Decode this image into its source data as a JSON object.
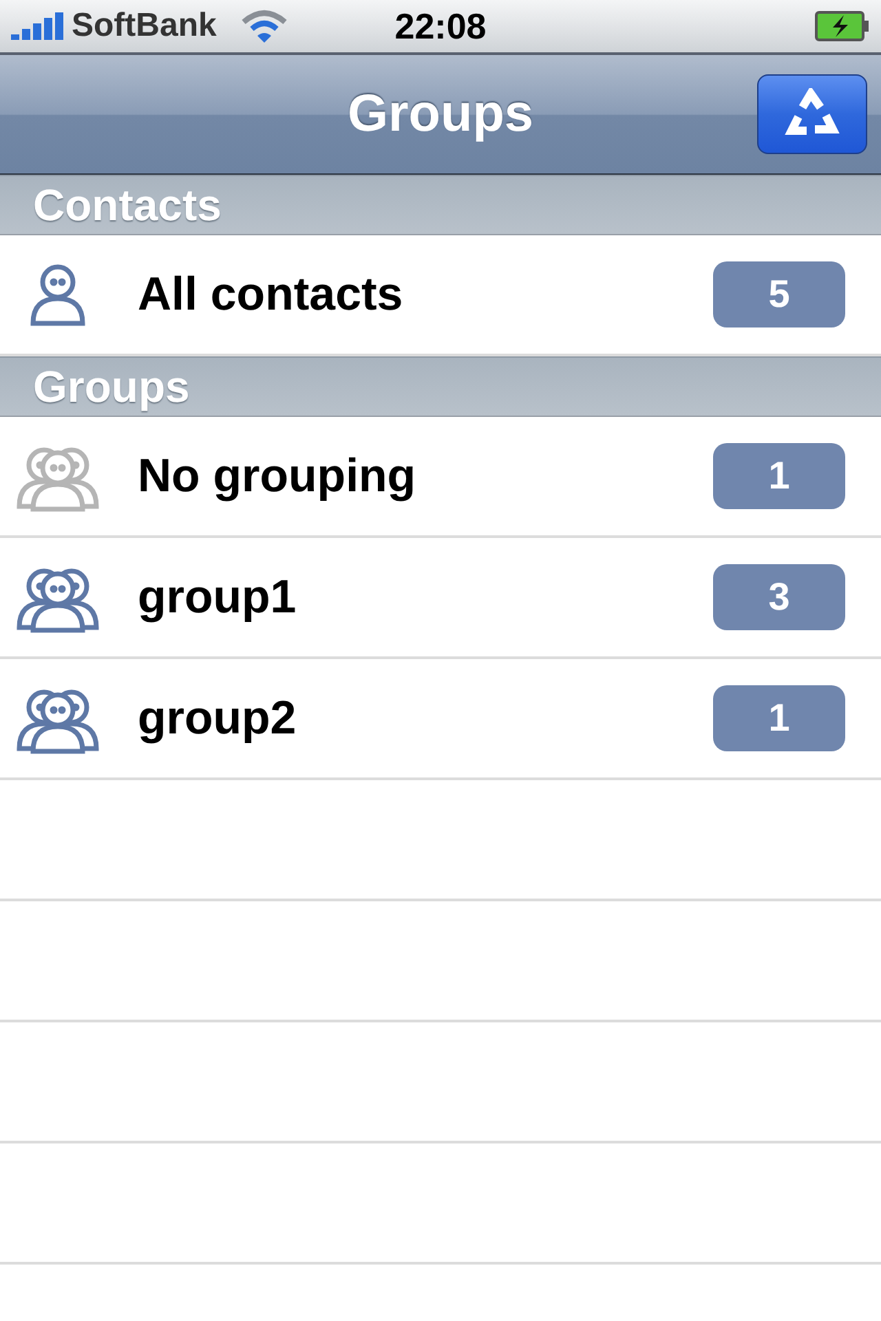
{
  "status_bar": {
    "carrier": "SoftBank",
    "time": "22:08"
  },
  "nav_bar": {
    "title": "Groups"
  },
  "sections": [
    {
      "header": "Contacts",
      "rows": [
        {
          "kind": "person",
          "label": "All contacts",
          "count": "5"
        }
      ]
    },
    {
      "header": "Groups",
      "rows": [
        {
          "kind": "ungrouped",
          "label": "No grouping",
          "count": "1"
        },
        {
          "kind": "group",
          "label": "group1",
          "count": "3"
        },
        {
          "kind": "group",
          "label": "group2",
          "count": "1"
        }
      ]
    }
  ]
}
